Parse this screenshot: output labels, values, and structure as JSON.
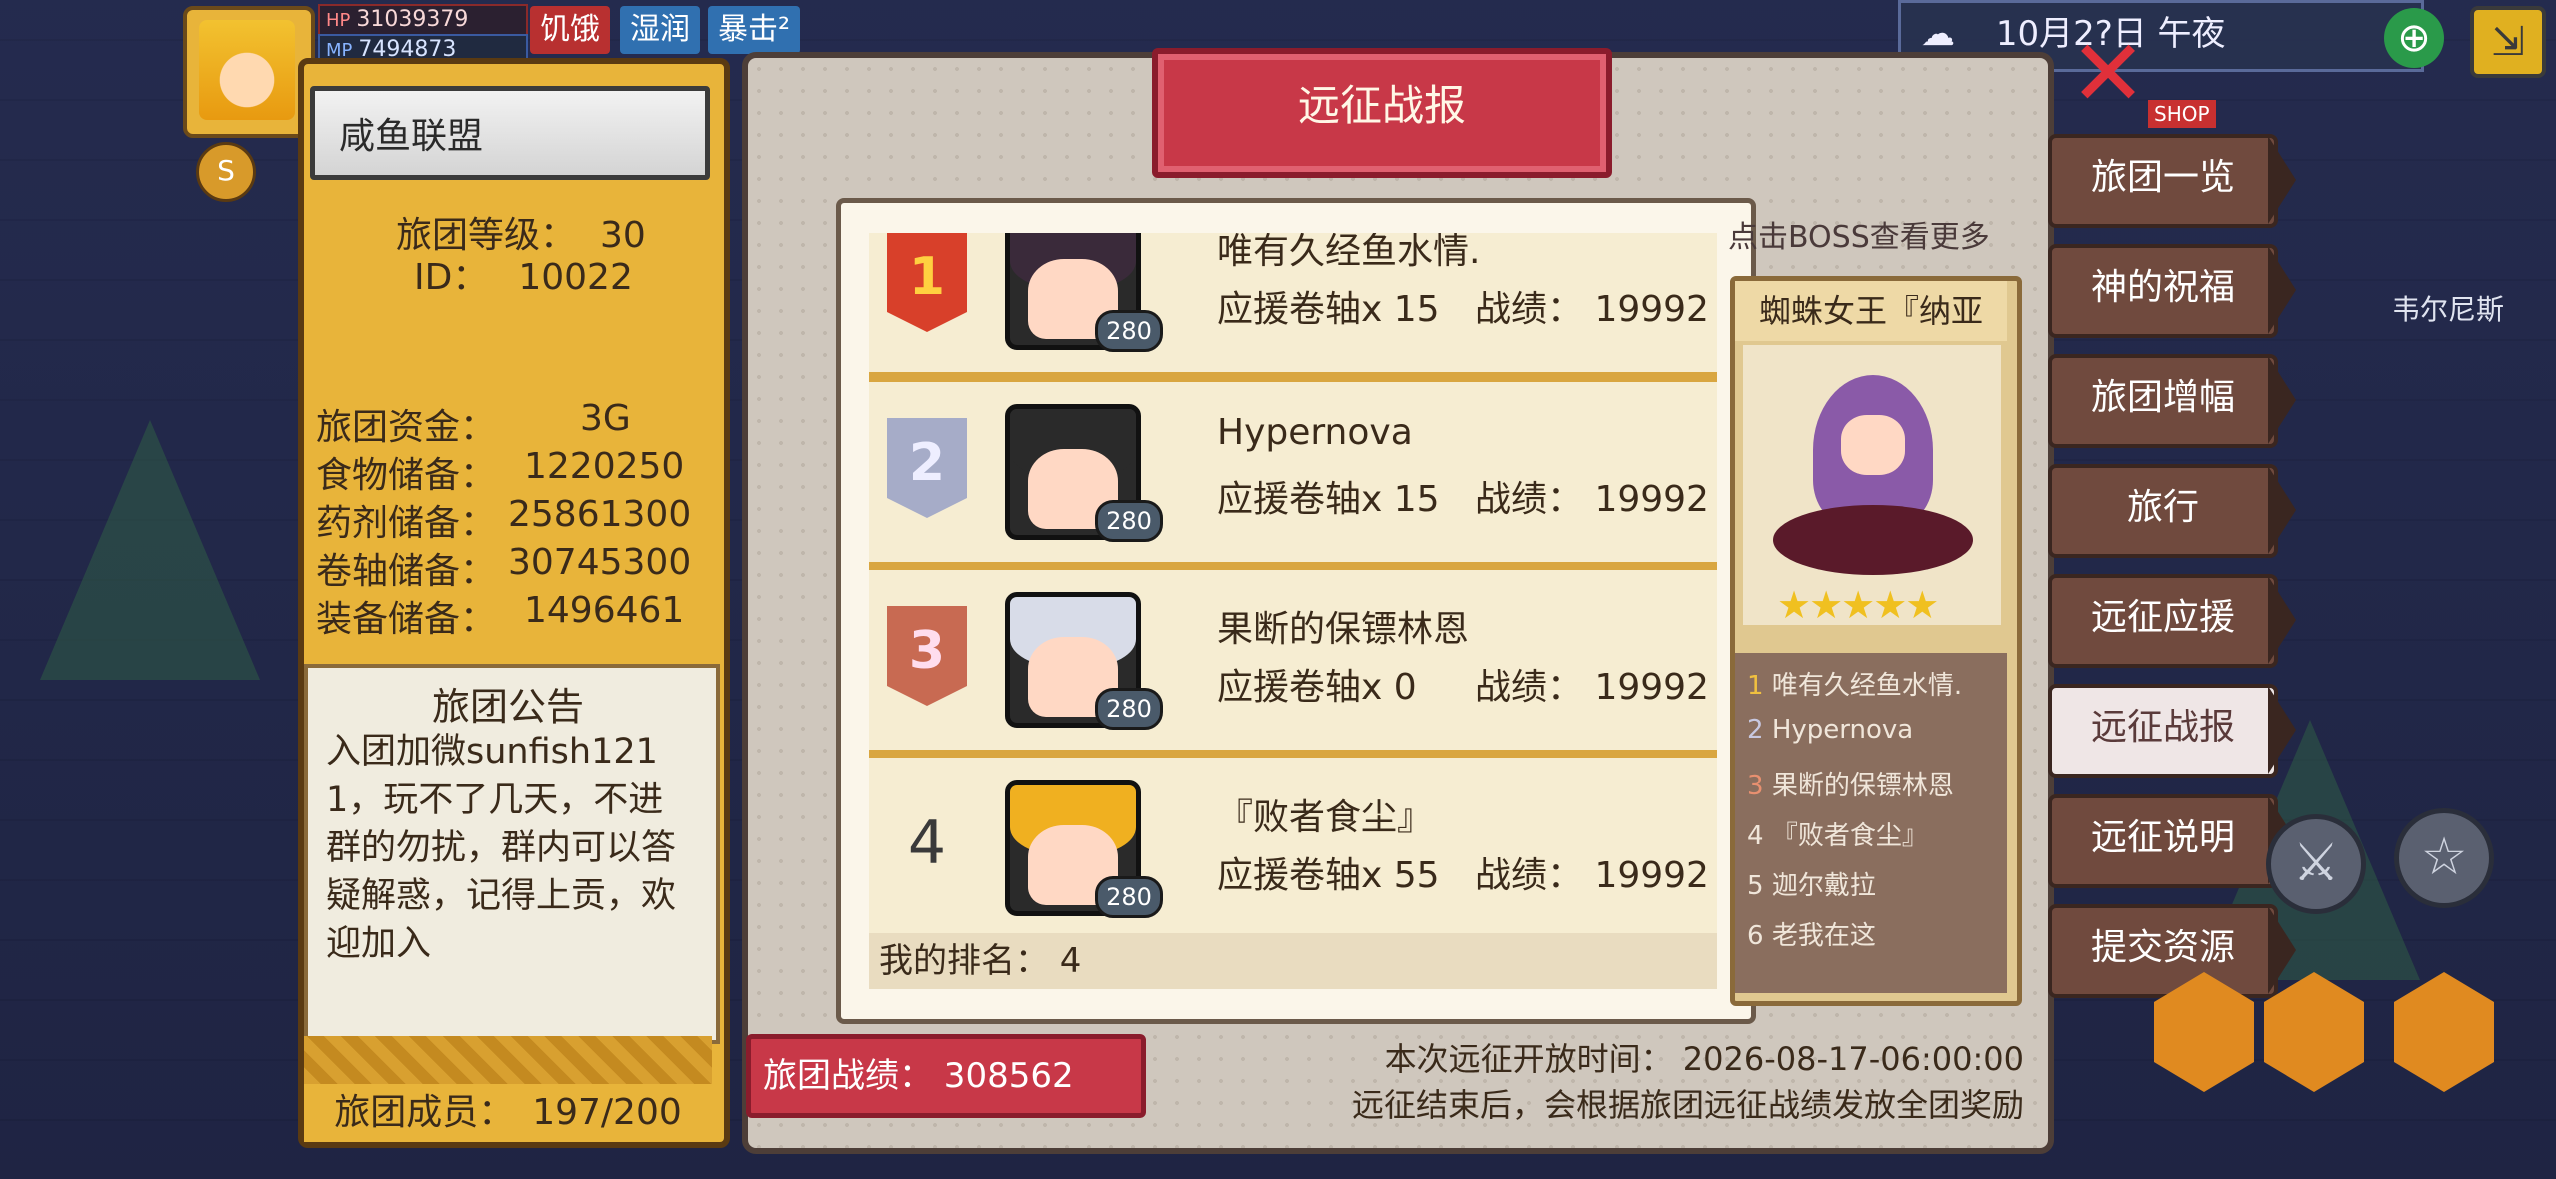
{
  "hud": {
    "hp_label": "HP",
    "hp_value": "31039379",
    "mp_label": "MP",
    "mp_value": "7494873",
    "status_hungry": "饥饿",
    "status_wet": "湿润",
    "status_crit": "暴击²",
    "clock": "10月2?日  午夜"
  },
  "guild": {
    "name": "咸鱼联盟",
    "level_label": "旅团等级：",
    "level_value": "30",
    "id_label": "ID：",
    "id_value": "10022",
    "funds_label": "旅团资金：",
    "funds_value": "3G",
    "food_label": "食物储备：",
    "food_value": "1220250",
    "potion_label": "药剂储备：",
    "potion_value": "25861300",
    "scroll_label": "卷轴储备：",
    "scroll_value": "30745300",
    "equip_label": "装备储备：",
    "equip_value": "1496461",
    "notice_title": "旅团公告",
    "notice_text": "入团加微sunfish1211，玩不了几天，不进群的勿扰，群内可以答疑解惑，记得上贡，欢迎加入",
    "members_label": "旅团成员：",
    "members_value": "197/200"
  },
  "panel": {
    "title": "远征战报",
    "boss_hint": "点击BOSS查看更多",
    "boss_name": "蜘蛛女王『纳亚",
    "boss_stars": 5,
    "my_rank": "我的排名：  4",
    "guild_score": "旅团战绩：  308562",
    "open_time": "本次远征开放时间：  2026-08-17-06:00:00",
    "reward_note": "远征结束后，会根据旅团远征战绩发放全团奖励"
  },
  "ranking": [
    {
      "rank": "1",
      "name": "唯有久经鱼水情.",
      "scroll": "应援卷轴x 15",
      "score": "战绩：   19992",
      "level": "280"
    },
    {
      "rank": "2",
      "name": "Hypernova",
      "scroll": "应援卷轴x 15",
      "score": "战绩：   19992",
      "level": "280"
    },
    {
      "rank": "3",
      "name": "果断的保镖林恩",
      "scroll": "应援卷轴x 0",
      "score": "战绩：   19992",
      "level": "280"
    },
    {
      "rank": "4",
      "name": "『败者食尘』",
      "scroll": "应援卷轴x 55",
      "score": "战绩：   19992",
      "level": "280"
    }
  ],
  "boss_list": [
    {
      "n": "1",
      "name": "唯有久经鱼水情."
    },
    {
      "n": "2",
      "name": "Hypernova"
    },
    {
      "n": "3",
      "name": "果断的保镖林恩"
    },
    {
      "n": "4",
      "name": "『败者食尘』"
    },
    {
      "n": "5",
      "name": "迦尔戴拉"
    },
    {
      "n": "6",
      "name": "老我在这"
    }
  ],
  "menu": [
    {
      "label": "旅团一览",
      "active": false
    },
    {
      "label": "神的祝福",
      "active": false
    },
    {
      "label": "旅团增幅",
      "active": false
    },
    {
      "label": "旅行",
      "active": false
    },
    {
      "label": "远征应援",
      "active": false
    },
    {
      "label": "远征战报",
      "active": true
    },
    {
      "label": "远征说明",
      "active": false
    },
    {
      "label": "提交资源",
      "active": false
    }
  ],
  "map": {
    "shop_label": "SHOP",
    "town_label": "韦尔尼斯"
  }
}
